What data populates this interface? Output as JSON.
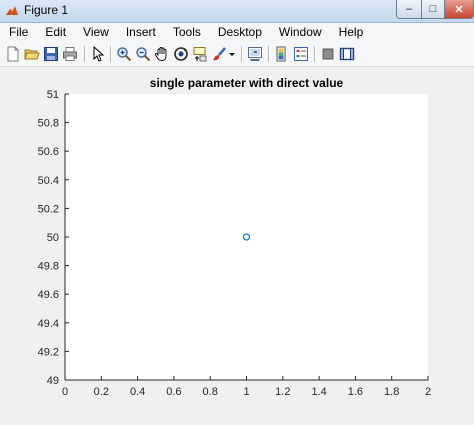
{
  "window": {
    "title": "Figure 1",
    "minimize_label": "–",
    "maximize_label": "□",
    "close_label": "✕"
  },
  "menu": {
    "items": [
      "File",
      "Edit",
      "View",
      "Insert",
      "Tools",
      "Desktop",
      "Window",
      "Help"
    ]
  },
  "toolbar": {
    "icons": [
      "new-figure-icon",
      "open-file-icon",
      "save-icon",
      "print-icon",
      "edit-plot-arrow-icon",
      "zoom-in-icon",
      "zoom-out-icon",
      "pan-hand-icon",
      "rotate-3d-icon",
      "data-cursor-icon",
      "brush-icon",
      "brush-dropdown-icon",
      "link-plot-icon",
      "insert-colorbar-icon",
      "insert-legend-icon",
      "hide-plot-tools-icon",
      "show-plot-tools-icon"
    ]
  },
  "colors": {
    "axes_background": "#ffffff",
    "marker": "#0072bd",
    "axis": "#262626"
  },
  "chart_data": {
    "type": "scatter",
    "title": "single parameter with direct value",
    "xlabel": "",
    "ylabel": "",
    "xlim": [
      0,
      2
    ],
    "ylim": [
      49,
      51
    ],
    "xticks": [
      "0",
      "0.2",
      "0.4",
      "0.6",
      "0.8",
      "1",
      "1.2",
      "1.4",
      "1.6",
      "1.8",
      "2"
    ],
    "yticks": [
      "49",
      "49.2",
      "49.4",
      "49.6",
      "49.8",
      "50",
      "50.2",
      "50.4",
      "50.6",
      "50.8",
      "51"
    ],
    "grid": false,
    "marker": "circle-open",
    "series": [
      {
        "x": [
          1
        ],
        "y": [
          50
        ]
      }
    ]
  }
}
